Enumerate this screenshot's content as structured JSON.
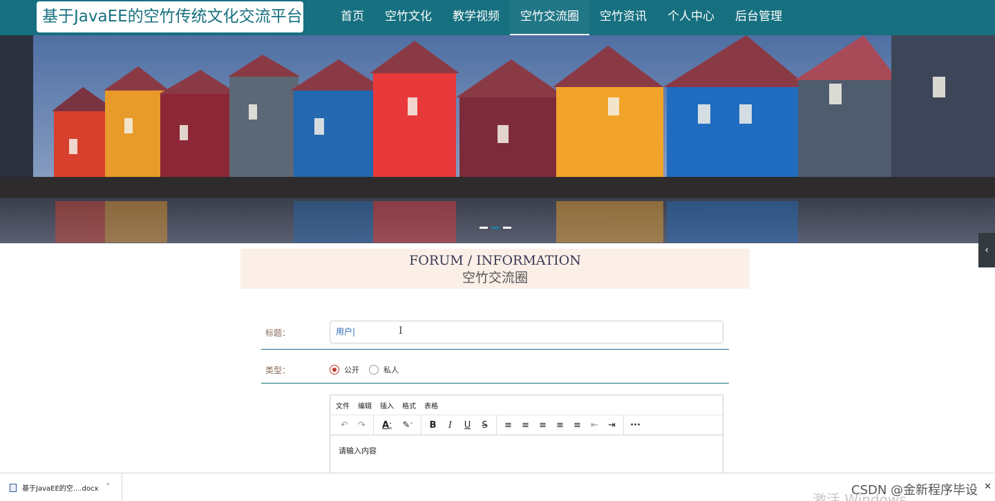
{
  "header": {
    "logo_text": "基于JavaEE的空竹传统文化交流平台",
    "nav": [
      {
        "label": "首页"
      },
      {
        "label": "空竹文化"
      },
      {
        "label": "教学视频"
      },
      {
        "label": "空竹交流圈",
        "active": true
      },
      {
        "label": "空竹资讯"
      },
      {
        "label": "个人中心"
      },
      {
        "label": "后台管理"
      }
    ]
  },
  "banner": {
    "image": "colorful-waterfront-houses",
    "slides": 3,
    "active_slide": 2
  },
  "section": {
    "title_en": "FORUM / INFORMATION",
    "title_cn": "空竹交流圈"
  },
  "form": {
    "title_label": "标题：",
    "title_value": "用户|",
    "type_label": "类型：",
    "type_options": [
      {
        "label": "公开",
        "checked": true
      },
      {
        "label": "私人",
        "checked": false
      }
    ]
  },
  "editor": {
    "menus": [
      "文件",
      "编辑",
      "插入",
      "格式",
      "表格"
    ],
    "placeholder": "请输入内容",
    "tools": [
      "undo-icon",
      "redo-icon",
      "text-color-icon",
      "highlight-icon",
      "bold-icon",
      "italic-icon",
      "underline-icon",
      "strikethrough-icon",
      "list-icon",
      "align-left-icon",
      "align-center-icon",
      "align-right-icon",
      "align-justify-icon",
      "outdent-icon",
      "indent-icon",
      "more-icon"
    ]
  },
  "download_bar": {
    "file_name": "基于JavaEE的空....docx"
  },
  "overlay": {
    "watermark": "CSDN @金新程序毕设",
    "activate_text": "激活 Windows"
  },
  "colors": {
    "header_bg": "#16707f",
    "accent_red": "#c0392b"
  }
}
